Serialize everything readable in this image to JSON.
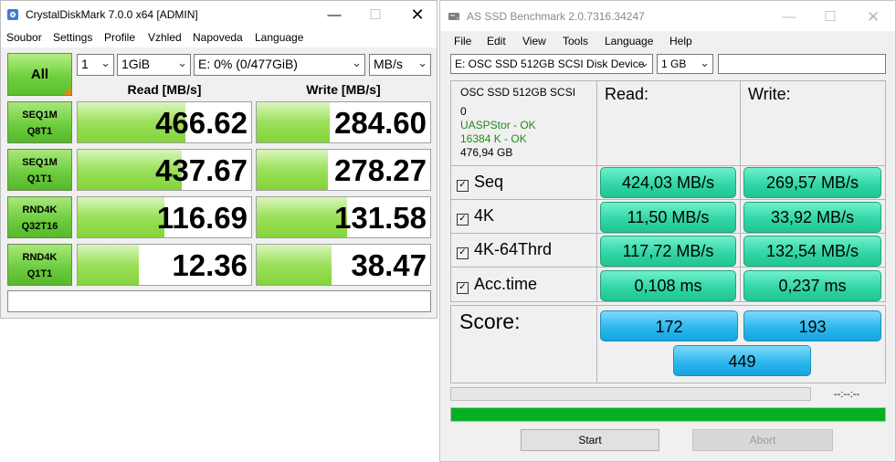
{
  "cdm": {
    "title": "CrystalDiskMark 7.0.0 x64 [ADMIN]",
    "menu": [
      "Soubor",
      "Settings",
      "Profile",
      "Vzhled",
      "Napoveda",
      "Language"
    ],
    "all_label": "All",
    "count_select": "1",
    "size_select": "1GiB",
    "drive_select": "E: 0% (0/477GiB)",
    "unit_select": "MB/s",
    "read_header": "Read [MB/s]",
    "write_header": "Write [MB/s]",
    "tests": [
      {
        "line1": "SEQ1M",
        "line2": "Q8T1",
        "read": "466.62",
        "write": "284.60"
      },
      {
        "line1": "SEQ1M",
        "line2": "Q1T1",
        "read": "437.67",
        "write": "278.27"
      },
      {
        "line1": "RND4K",
        "line2": "Q32T16",
        "read": "116.69",
        "write": "131.58"
      },
      {
        "line1": "RND4K",
        "line2": "Q1T1",
        "read": "12.36",
        "write": "38.47"
      }
    ],
    "bar_fill": [
      {
        "read": 0.62,
        "write": 0.42
      },
      {
        "read": 0.6,
        "write": 0.41
      },
      {
        "read": 0.5,
        "write": 0.52
      },
      {
        "read": 0.35,
        "write": 0.43
      }
    ],
    "comment": ""
  },
  "asssd": {
    "title": "AS SSD Benchmark 2.0.7316.34247",
    "menu": [
      "File",
      "Edit",
      "View",
      "Tools",
      "Language",
      "Help"
    ],
    "device_select": "E: OSC SSD 512GB SCSI Disk Device",
    "size_select": "1 GB",
    "device_info": {
      "name": "OSC SSD 512GB SCSI",
      "line2": "0",
      "driver": "UASPStor - OK",
      "align": "16384 K - OK",
      "capacity": "476,94 GB"
    },
    "read_header": "Read:",
    "write_header": "Write:",
    "rows": [
      {
        "label": "Seq",
        "read": "424,03 MB/s",
        "write": "269,57 MB/s"
      },
      {
        "label": "4K",
        "read": "11,50 MB/s",
        "write": "33,92 MB/s"
      },
      {
        "label": "4K-64Thrd",
        "read": "117,72 MB/s",
        "write": "132,54 MB/s"
      },
      {
        "label": "Acc.time",
        "read": "0,108 ms",
        "write": "0,237 ms"
      }
    ],
    "score_label": "Score:",
    "score_read": "172",
    "score_write": "193",
    "score_total": "449",
    "time_display": "--:--:--",
    "progress_top": 0,
    "progress_bottom": 1,
    "start_label": "Start",
    "abort_label": "Abort",
    "colors": {
      "ok_text": "#1f8a1f",
      "progress": "#06b025"
    }
  }
}
